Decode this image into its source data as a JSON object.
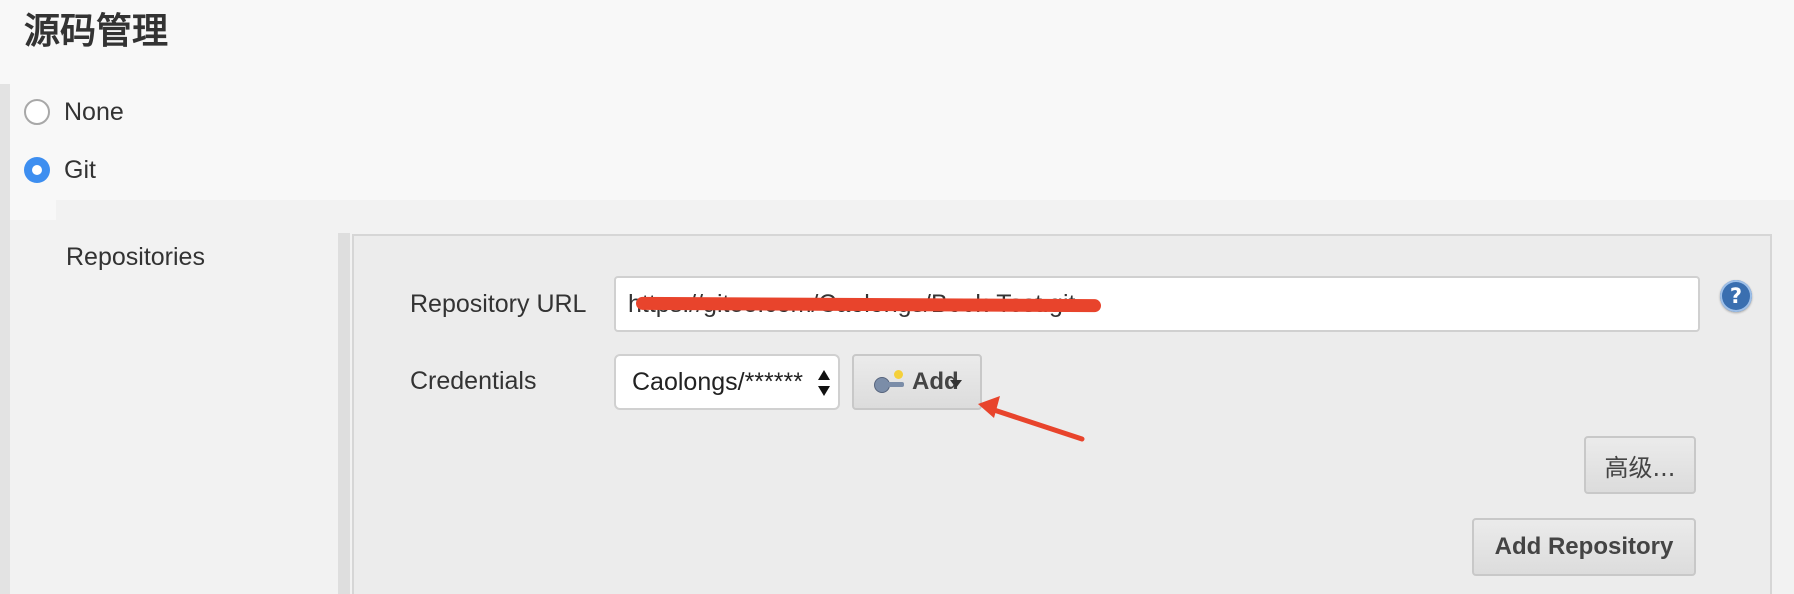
{
  "section": {
    "title": "源码管理"
  },
  "scm_options": [
    {
      "label": "None",
      "selected": false
    },
    {
      "label": "Git",
      "selected": true
    }
  ],
  "repositories": {
    "label": "Repositories",
    "repository_url": {
      "label": "Repository URL",
      "value": "https://gitee.com/Caolongs/Book-Test.git"
    },
    "credentials": {
      "label": "Credentials",
      "selected": "Caolongs/******",
      "add_button": "Add"
    },
    "advanced_button": "高级...",
    "add_repository_button": "Add Repository"
  },
  "icons": {
    "help": "help-icon",
    "key": "key-icon",
    "caret": "caret-down-icon"
  },
  "colors": {
    "radio_selected": "#3d8ef0",
    "annotation_arrow": "#e8442c",
    "help_icon": "#3a6fb0"
  }
}
